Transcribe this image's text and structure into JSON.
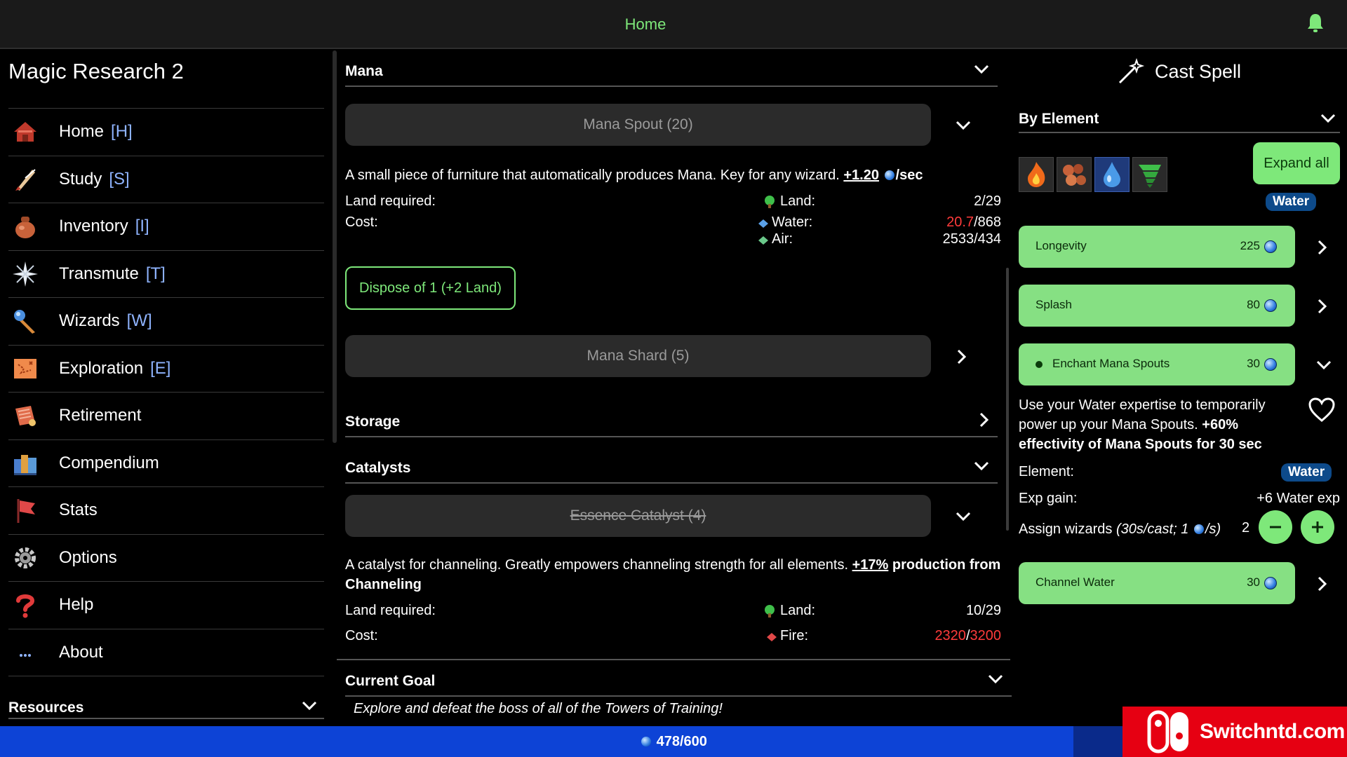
{
  "topbar": {
    "home": "Home"
  },
  "app_title": "Magic Research 2",
  "nav": [
    {
      "label": "Home",
      "key": "[H]",
      "icon": "house-icon"
    },
    {
      "label": "Study",
      "key": "[S]",
      "icon": "quill-icon"
    },
    {
      "label": "Inventory",
      "key": "[I]",
      "icon": "pouch-icon"
    },
    {
      "label": "Transmute",
      "key": "[T]",
      "icon": "sparkle-icon"
    },
    {
      "label": "Wizards",
      "key": "[W]",
      "icon": "wand-icon"
    },
    {
      "label": "Exploration",
      "key": "[E]",
      "icon": "map-icon"
    },
    {
      "label": "Retirement",
      "key": "",
      "icon": "scroll-icon"
    },
    {
      "label": "Compendium",
      "key": "",
      "icon": "books-icon"
    },
    {
      "label": "Stats",
      "key": "",
      "icon": "flag-icon"
    },
    {
      "label": "Options",
      "key": "",
      "icon": "gear-icon"
    },
    {
      "label": "Help",
      "key": "",
      "icon": "question-icon"
    },
    {
      "label": "About",
      "key": "",
      "icon": "ellipsis-icon"
    }
  ],
  "resources_label": "Resources",
  "mana": {
    "title": "Mana",
    "spout_button": "Mana Spout (20)",
    "spout_desc": "A small piece of furniture that automatically produces Mana. Key for any wizard.",
    "spout_rate": "+1.20",
    "spout_rate_unit": "/sec",
    "land_required_label": "Land required:",
    "land_label": "Land:",
    "spout_land_value": "2/29",
    "cost_label": "Cost:",
    "water_label": "Water:",
    "water_have": "20.7",
    "water_need": "/868",
    "air_label": "Air:",
    "air_value": "2533/434",
    "dispose_button": "Dispose of 1 (+2 Land)",
    "shard_button": "Mana Shard (5)"
  },
  "storage": {
    "title": "Storage"
  },
  "catalysts": {
    "title": "Catalysts",
    "essence_button": "Essence Catalyst (4)",
    "desc": "A catalyst for channeling. Greatly empowers channeling strength for all elements.",
    "bonus": "+17%",
    "bonus_text": "production from Channeling",
    "land_required_label": "Land required:",
    "land_label": "Land:",
    "land_value": "10/29",
    "cost_label": "Cost:",
    "fire_label": "Fire:",
    "fire_have": "2320",
    "fire_sep": "/",
    "fire_need": "3200"
  },
  "goal": {
    "title": "Current Goal",
    "text": "Explore and defeat the boss of all of the Towers of Training!"
  },
  "cast": {
    "title": "Cast Spell",
    "by_element": "By Element",
    "expand_all": "Expand all",
    "selected_element": "Water",
    "spells": [
      {
        "name": "Longevity",
        "cost": "225"
      },
      {
        "name": "Splash",
        "cost": "80"
      },
      {
        "name": "Enchant Mana Spouts",
        "cost": "30"
      },
      {
        "name": "Channel Water",
        "cost": "30"
      }
    ],
    "desc": "Use your Water expertise to temporarily power up your Mana Spouts.",
    "desc_bold": "+60% effectivity of Mana Spouts for 30 sec",
    "element_label": "Element:",
    "element_value": "Water",
    "exp_label": "Exp gain:",
    "exp_value": "+6 Water exp",
    "assign_label": "Assign wizards",
    "assign_detail_a": "(30s/cast; 1",
    "assign_detail_b": "/s)",
    "assign_count": "2"
  },
  "mana_bar": {
    "text": "478/600",
    "fraction": 0.797
  },
  "watermark": {
    "text": "Switchntd.com"
  },
  "colors": {
    "accent_green": "#7ee87a",
    "bar_blue": "#0d43d6",
    "water_badge": "#0d4a8a",
    "warn_red": "#ff3b3b"
  }
}
